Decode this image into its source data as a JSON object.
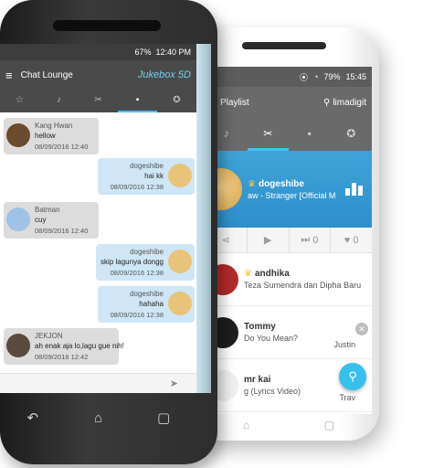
{
  "front": {
    "status": {
      "time": "12:40 PM",
      "battery": "67%"
    },
    "app": {
      "title": "Chat Lounge",
      "logo": "Jukebox 5D"
    },
    "tabs": [
      {
        "icon": "star-icon",
        "glyph": "☆",
        "active": false
      },
      {
        "icon": "note-icon",
        "glyph": "♪",
        "active": false
      },
      {
        "icon": "flame-icon",
        "glyph": "✂",
        "active": false
      },
      {
        "icon": "chat-icon",
        "glyph": "▪",
        "active": true
      },
      {
        "icon": "badge-icon",
        "glyph": "✪",
        "active": false
      }
    ],
    "messages": [
      {
        "dir": "in",
        "name": "Kang Hwan",
        "text": "hellow",
        "time": "08/09/2016 12:40",
        "avatar": "#6b4a2e"
      },
      {
        "dir": "out",
        "name": "dogeshibe",
        "text": "hai kk",
        "time": "08/09/2016 12:38",
        "avatar": "#e8c37a"
      },
      {
        "dir": "in",
        "name": "Batman",
        "text": "cuy",
        "time": "08/09/2016 12:40",
        "avatar": "#9fc3e6"
      },
      {
        "dir": "out",
        "name": "dogeshibe",
        "text": "skip lagunya dongg",
        "time": "08/09/2016 12:38",
        "avatar": "#e8c37a"
      },
      {
        "dir": "out",
        "name": "dogeshibe",
        "text": "hahaha",
        "time": "08/09/2016 12:38",
        "avatar": "#e8c37a"
      },
      {
        "dir": "in",
        "name": "JEKJON",
        "text": "ah enak aja lo,lagu gue nih!",
        "time": "08/09/2016 12:42",
        "avatar": "#5a4a40"
      }
    ],
    "send_icon": "➤",
    "nav": {
      "back": "↶",
      "home": "⌂",
      "recent": "▢"
    }
  },
  "back": {
    "status": {
      "time": "15:45",
      "battery": "79%"
    },
    "app": {
      "title": "Playlist",
      "location": "limadigit"
    },
    "tabs": [
      {
        "glyph": "♪",
        "active": false
      },
      {
        "glyph": "✂",
        "active": true
      },
      {
        "glyph": "▪",
        "active": false
      },
      {
        "glyph": "✪",
        "active": false
      }
    ],
    "now_playing": {
      "user": "dogeshibe",
      "track": "aw - Stranger [Official M"
    },
    "controls": {
      "skip_count": "0",
      "like_count": "0"
    },
    "queue": [
      {
        "user": "andhika",
        "track": "Teza Sumendra dan Dipha Baru",
        "side": "",
        "avatar": "#b22a2a",
        "crown": true
      },
      {
        "user": "Tommy",
        "track": "Do You Mean?",
        "side": "Justin",
        "avatar": "#1e1e1e",
        "crown": false
      },
      {
        "user": "mr kai",
        "track": "g (Lyrics Video)",
        "side": "Trav",
        "avatar": "#888888",
        "crown": false
      }
    ],
    "nav": {
      "home": "⌂",
      "recent": "▢"
    }
  }
}
